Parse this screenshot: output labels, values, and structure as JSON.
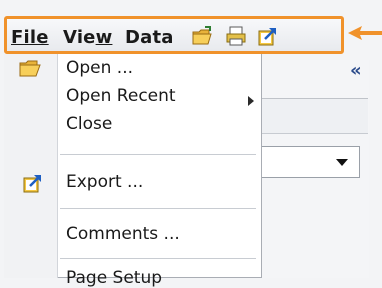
{
  "menubar": {
    "file_label": "File",
    "view_label_pre": "Vie",
    "view_label_u": "w",
    "data_label": "Data",
    "toolbar_icons": [
      "open-folder-icon",
      "print-icon",
      "export-icon"
    ],
    "highlight_color": "#f0922b"
  },
  "panel": {
    "collapse_glyph": "«"
  },
  "file_menu": {
    "items": [
      {
        "label": "Open ...",
        "icon": "open-folder-icon"
      },
      {
        "label": "Open Recent",
        "has_submenu": true
      },
      {
        "label": "Close"
      },
      {
        "label": "Export ...",
        "icon": "export-icon"
      },
      {
        "label": "Comments ..."
      },
      {
        "label": "Page Setup"
      }
    ]
  }
}
